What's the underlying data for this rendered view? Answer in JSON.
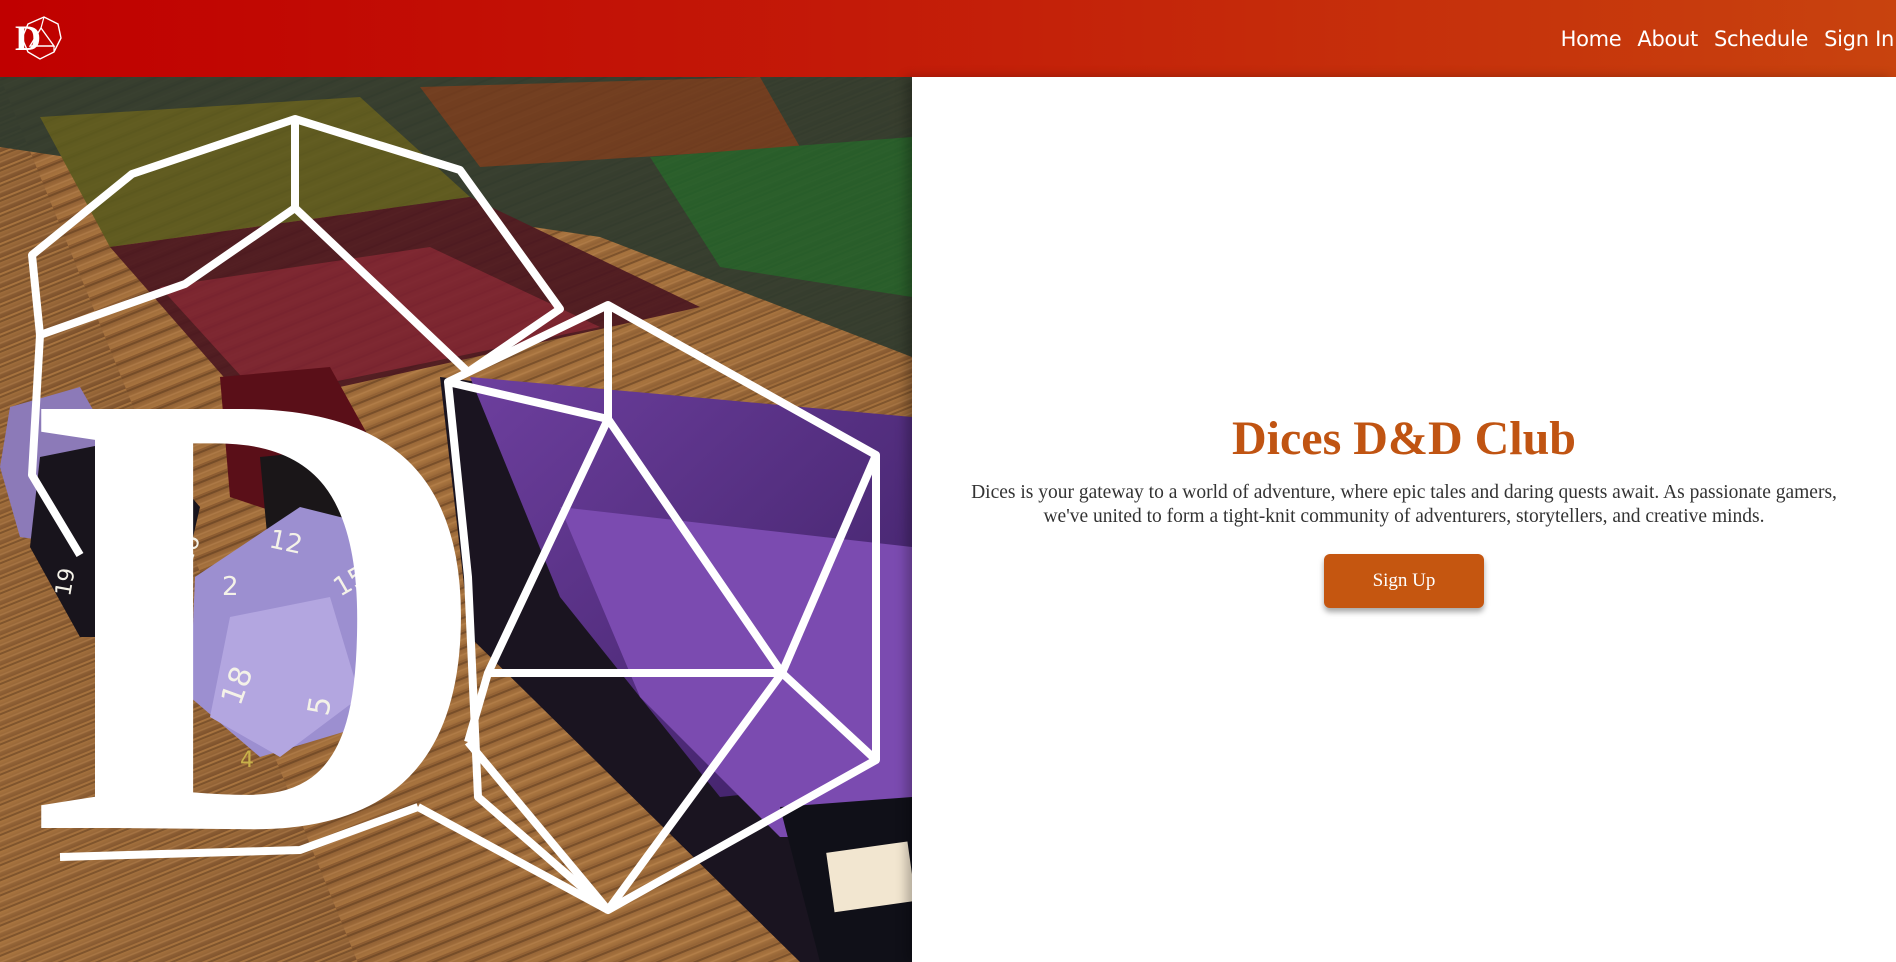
{
  "brand": {
    "logo_icon": "d-d20-logo-icon",
    "letter": "D"
  },
  "nav": {
    "items": [
      "Home",
      "About",
      "Schedule",
      "Sign In"
    ]
  },
  "hero": {
    "title": "Dices D&D Club",
    "description": "Dices is your gateway to a world of adventure, where epic tales and daring quests await. As passionate gamers, we've united to form a tight-knit community of adventurers, storytellers, and creative minds.",
    "cta_label": "Sign Up",
    "die_face_numbers": [
      "12",
      "2",
      "15",
      "18",
      "5",
      "4",
      "16",
      "19"
    ]
  },
  "colors": {
    "header_start": "#c00000",
    "header_end": "#c8430e",
    "accent": "#c05412",
    "button": "#c55610",
    "text": "#333333"
  }
}
